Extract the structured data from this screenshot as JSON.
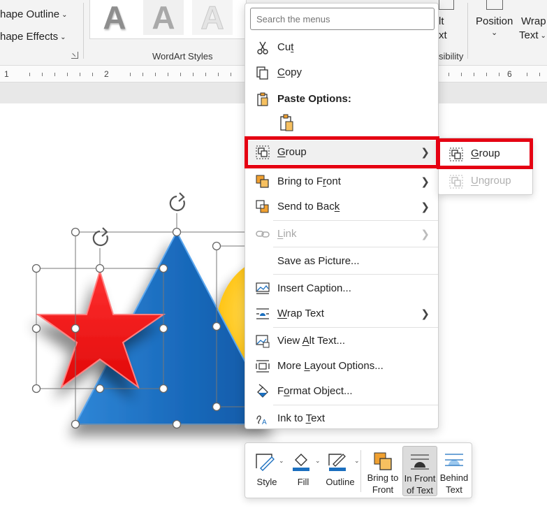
{
  "ribbon": {
    "shape_outline": "hape Outline",
    "shape_effects": "hape Effects",
    "wordart_label": "WordArt Styles",
    "wordart_samples": [
      "A",
      "A",
      "A"
    ],
    "alt_text_top": "lt",
    "alt_text_bottom": "xt",
    "accessibility_label": "sibility",
    "position_label": "Position",
    "wrap_text_top": "Wrap",
    "wrap_text_bottom": "Text"
  },
  "ruler": {
    "marks": [
      "1",
      "2",
      "6"
    ]
  },
  "context_menu": {
    "search_placeholder": "Search the menus",
    "items": [
      {
        "label": "Cut",
        "icon": "scissors-icon",
        "underline": "t",
        "prefix": "Cu"
      },
      {
        "label": "Copy",
        "icon": "copy-icon",
        "prefix": "",
        "underline": "C",
        "suffix": "opy"
      },
      {
        "label": "Paste Options:",
        "icon": "paste-icon"
      },
      {
        "label": "Group",
        "icon": "group-icon",
        "prefix": "",
        "underline": "G",
        "suffix": "roup"
      },
      {
        "label": "Bring to Front",
        "icon": "bring-to-front-icon",
        "prefix": "Bring to F",
        "underline": "r",
        "suffix": "ont"
      },
      {
        "label": "Send to Back",
        "icon": "send-to-back-icon",
        "prefix": "Send to Bac",
        "underline": "k",
        "suffix": ""
      },
      {
        "label": "Link",
        "icon": "link-icon",
        "prefix": "",
        "underline": "L",
        "suffix": "ink"
      },
      {
        "label": "Save as Picture...",
        "prefix": "Save as Picture...",
        "underline": "",
        "suffix": ""
      },
      {
        "label": "Insert Caption...",
        "icon": "insert-caption-icon",
        "prefix": "Insert Caption...",
        "underline": "",
        "suffix": ""
      },
      {
        "label": "Wrap Text",
        "icon": "wrap-text-icon",
        "prefix": "",
        "underline": "W",
        "suffix": "rap Text"
      },
      {
        "label": "View Alt Text...",
        "icon": "alt-text-icon",
        "prefix": "View ",
        "underline": "A",
        "suffix": "lt Text..."
      },
      {
        "label": "More Layout Options...",
        "icon": "layout-options-icon",
        "prefix": "More ",
        "underline": "L",
        "suffix": "ayout Options..."
      },
      {
        "label": "Format Object...",
        "icon": "format-object-icon",
        "prefix": "F",
        "underline": "o",
        "suffix": "rmat Object..."
      },
      {
        "label": "Ink to Text",
        "icon": "ink-to-text-icon",
        "prefix": "Ink to ",
        "underline": "T",
        "suffix": "ext"
      }
    ]
  },
  "submenu": {
    "items": [
      {
        "label": "Group",
        "prefix": "",
        "underline": "G",
        "suffix": "roup",
        "enabled": true
      },
      {
        "label": "Ungroup",
        "prefix": "",
        "underline": "U",
        "suffix": "ngroup",
        "enabled": false
      }
    ]
  },
  "mini_toolbar": {
    "style": "Style",
    "fill": "Fill",
    "outline": "Outline",
    "bring_to_front_1": "Bring to",
    "bring_to_front_2": "Front",
    "in_front_1": "In Front",
    "in_front_2": "of Text",
    "behind_1": "Behind",
    "behind_2": "Text"
  },
  "colors": {
    "highlight": "#e50012",
    "star": "#ee1111",
    "triangle": "#1b6fbf",
    "circle": "#ffc20e"
  }
}
